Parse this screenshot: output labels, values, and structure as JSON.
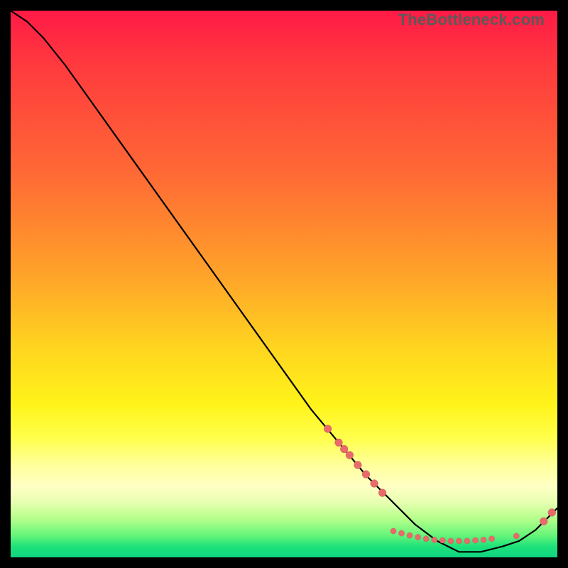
{
  "watermark": "TheBottleneck.com",
  "colors": {
    "background": "#000000",
    "curve": "#000000",
    "dot": "#e86a6a",
    "gradient_top": "#ff1a46",
    "gradient_bottom": "#0fd480"
  },
  "chart_data": {
    "type": "line",
    "title": "",
    "xlabel": "",
    "ylabel": "",
    "xlim": [
      0,
      100
    ],
    "ylim": [
      0,
      100
    ],
    "grid": false,
    "legend": false,
    "notes": "No axis ticks or numeric labels are rendered. Curve is a bottleneck-style V: steep descent from top-left, minimum near x≈82, rising toward bottom-right. Salmon dots cluster on the descending slope around x≈58–68 and densely along the trough x≈70–93, with a final pair near x≈98.",
    "series": [
      {
        "name": "bottleneck-curve",
        "x": [
          0,
          3,
          6,
          10,
          15,
          20,
          25,
          30,
          35,
          40,
          45,
          50,
          55,
          60,
          65,
          70,
          74,
          78,
          82,
          86,
          90,
          93,
          96,
          98,
          100
        ],
        "y": [
          100,
          98,
          95,
          90,
          83,
          76,
          69,
          62,
          55,
          48,
          41,
          34,
          27,
          21,
          15,
          10,
          6,
          3,
          1,
          1,
          2,
          3,
          5,
          7,
          9
        ]
      }
    ],
    "points": [
      {
        "name": "slope-cluster",
        "coords": [
          {
            "x": 58,
            "y": 23.5
          },
          {
            "x": 60,
            "y": 21.0
          },
          {
            "x": 61,
            "y": 19.8
          },
          {
            "x": 62,
            "y": 18.7
          },
          {
            "x": 63.5,
            "y": 16.9
          },
          {
            "x": 65,
            "y": 15.2
          },
          {
            "x": 66.5,
            "y": 13.5
          },
          {
            "x": 68,
            "y": 11.8
          }
        ]
      },
      {
        "name": "trough-cluster",
        "coords": [
          {
            "x": 70,
            "y": 4.8
          },
          {
            "x": 71.5,
            "y": 4.4
          },
          {
            "x": 73,
            "y": 4.0
          },
          {
            "x": 74.5,
            "y": 3.7
          },
          {
            "x": 76,
            "y": 3.4
          },
          {
            "x": 77.5,
            "y": 3.2
          },
          {
            "x": 79,
            "y": 3.1
          },
          {
            "x": 80.5,
            "y": 3.0
          },
          {
            "x": 82,
            "y": 3.0
          },
          {
            "x": 83.5,
            "y": 3.0
          },
          {
            "x": 85,
            "y": 3.1
          },
          {
            "x": 86.5,
            "y": 3.2
          },
          {
            "x": 88,
            "y": 3.4
          },
          {
            "x": 92.5,
            "y": 3.9
          }
        ]
      },
      {
        "name": "tail-points",
        "coords": [
          {
            "x": 97.5,
            "y": 6.6
          },
          {
            "x": 99.0,
            "y": 8.2
          }
        ]
      }
    ]
  }
}
